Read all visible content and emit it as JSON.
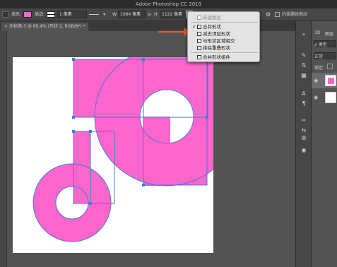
{
  "app": {
    "title": "Adobe Photoshop CC 2019"
  },
  "options_bar": {
    "fill_label": "填充:",
    "stroke_label": "描边:",
    "stroke_width": "1 像素",
    "w_label": "W:",
    "w_value": "1064 像素",
    "link_icon": "⊖",
    "h_label": "H:",
    "h_value": "1122 像素",
    "align_edges_label": "约束路径拖动",
    "fill_color": "#ff66cc"
  },
  "tabs": [
    {
      "label": "× 未标题-3 @ 85.4% (形状 2, RGB/8*) *"
    }
  ],
  "path_ops_menu": {
    "items": [
      {
        "label": "新建图层",
        "checked": false,
        "disabled": true
      },
      {
        "label": "合并形状",
        "checked": true,
        "disabled": false
      },
      {
        "label": "减去顶层形状",
        "checked": false,
        "disabled": false
      },
      {
        "label": "与形状区域相交",
        "checked": false,
        "disabled": false
      },
      {
        "label": "排除重叠形状",
        "checked": false,
        "disabled": false
      },
      {
        "label": "合并形状组件",
        "checked": false,
        "disabled": false
      }
    ]
  },
  "right_panel": {
    "tab_3d": "3D",
    "tab_layers": "图层",
    "kind_label": "ρ 类型",
    "blend_mode": "正常",
    "lock_label": "锁定:"
  },
  "colors": {
    "shape_fill": "#ff66cc",
    "path_stroke": "#3d7bd9",
    "arrow": "#e4572e"
  }
}
